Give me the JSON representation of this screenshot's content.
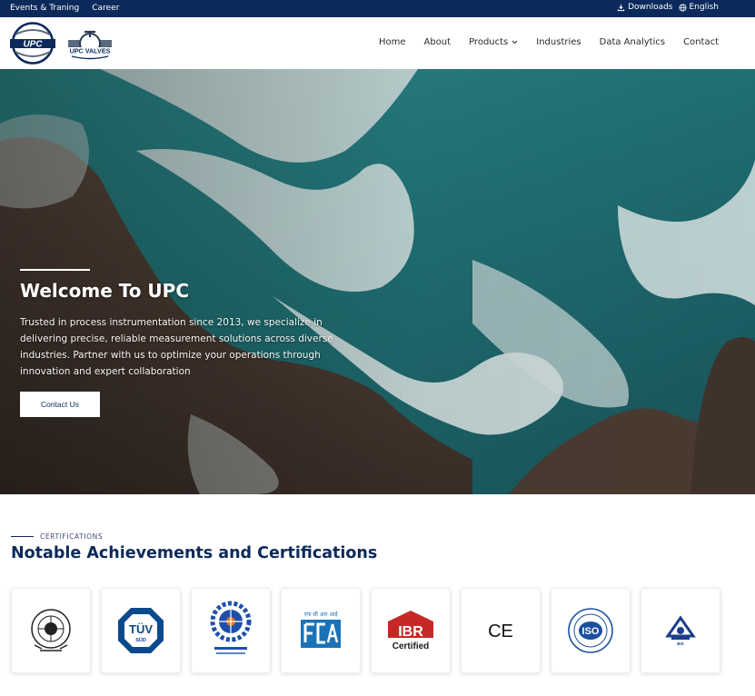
{
  "topbar": {
    "links": [
      "Events & Traning",
      "Career"
    ],
    "downloads": "Downloads",
    "language": "English",
    "icons": [
      "download-icon",
      "globe-icon"
    ]
  },
  "header": {
    "logo_upc": "UPC",
    "logo_valves": "UPC VALVES",
    "nav": [
      "Home",
      "About",
      "Products",
      "Industries",
      "Data Analytics",
      "Contact"
    ]
  },
  "hero": {
    "title": "Welcome To UPC",
    "text": "Trusted in process instrumentation since 2013, we specialize in delivering precise, reliable measurement solutions across diverse industries. Partner with us to optimize your operations through innovation and expert collaboration",
    "button": "Contact Us"
  },
  "certifications": {
    "eyebrow": "CERTIFICATIONS",
    "title": "Notable Achievements and Certifications",
    "cards": [
      {
        "logo": "government-seal-logo"
      },
      {
        "logo": "tuv-sud-logo",
        "text": "TÜV",
        "subtext": "SÜD"
      },
      {
        "logo": "csir-logo"
      },
      {
        "logo": "fcri-logo",
        "text": "एफ सी आर आई"
      },
      {
        "logo": "ibr-certified-logo",
        "text": "IBR",
        "subtext": "Certified"
      },
      {
        "logo": "ce-mark-logo",
        "text": "CE"
      },
      {
        "logo": "iso-certified-logo",
        "text": "ISO"
      },
      {
        "logo": "bis-logo",
        "text": "BIS"
      }
    ]
  },
  "colors": {
    "brand_navy": "#0b2a5b",
    "ibr_red": "#c62828",
    "tuv_blue": "#0a4a8c"
  }
}
